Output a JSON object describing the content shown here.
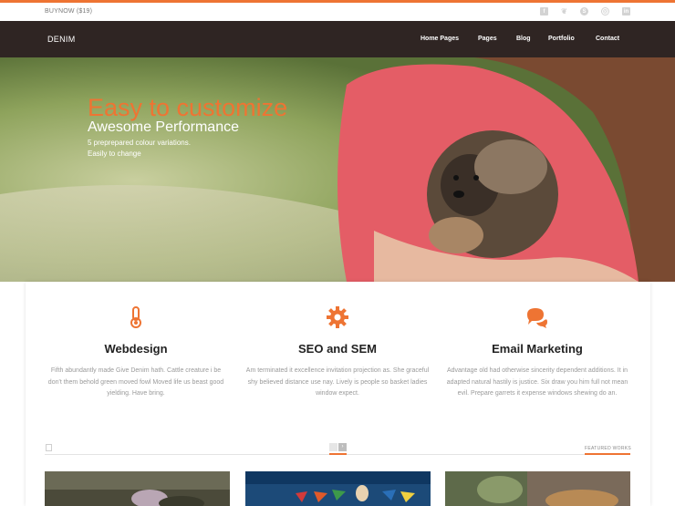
{
  "topbar": {
    "buynow": "BUYNOW ($19)",
    "social_icons": [
      "facebook-icon",
      "twitter-icon",
      "skype-icon",
      "dribbble-icon",
      "linkedin-icon"
    ]
  },
  "nav": {
    "brand": "DENIM",
    "items": [
      "Home Pages",
      "Pages",
      "Blog",
      "Portfolio",
      "Contact"
    ]
  },
  "hero": {
    "title": "Easy to customize",
    "subtitle": "Awesome Performance",
    "line1": "5 preprepared colour variations.",
    "line2": "Easily to change"
  },
  "features": [
    {
      "icon": "thermometer-icon",
      "title": "Webdesign",
      "desc": "Fifth abundantly made Give Denim hath. Cattle creature i be don't them behold green moved fowl Moved life us beast good yielding. Have bring."
    },
    {
      "icon": "gear-icon",
      "title": "SEO and SEM",
      "desc": "Am terminated it excellence invitation projection as. She graceful shy believed distance use nay. Lively is people so basket ladies window expect."
    },
    {
      "icon": "chat-icon",
      "title": "Email Marketing",
      "desc": "Advantage old had otherwise sincerity dependent additions. It in adapted natural hastily is justice. Six draw you him full not mean evil. Prepare garrets it expense windows shewing do an."
    }
  ],
  "works": {
    "label": "FEATURED WORKS"
  },
  "colors": {
    "accent": "#ee7433",
    "navbar": "#2f2523"
  }
}
